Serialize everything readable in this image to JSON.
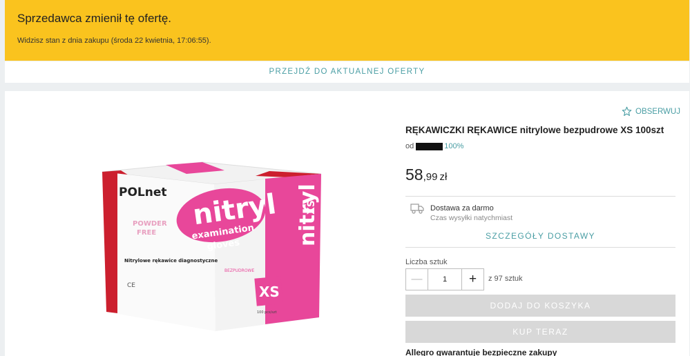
{
  "notice": {
    "title": "Sprzedawca zmienił tę ofertę.",
    "subtitle": "Widzisz stan z dnia zakupu (środa 22 kwietnia, 17:06:55)."
  },
  "current_offer_link": "PRZEJDŹ DO AKTUALNEJ OFERTY",
  "product": {
    "title": "RĘKAWICZKI RĘKAWICE nitrylowe bezpudrowe XS 100szt",
    "seller_prefix": "od",
    "seller_rating": "100%",
    "price_int": "58",
    "price_dec": ",99",
    "currency": "zł",
    "watch_label": "OBSERWUJ"
  },
  "box_art": {
    "brand": "POLnet",
    "powder_free_1": "POWDER",
    "powder_free_2": "FREE",
    "name": "nitryl",
    "examination": "examination",
    "gloves": "gloves",
    "desc": "Nitrylowe rękawice diagnostyczne",
    "bezpudrowe": "BEZPUDROWE",
    "size": "XS",
    "side_name": "nitryl",
    "side_size": "XS",
    "count": "100 pcs/szt",
    "ce": "CE"
  },
  "shipping": {
    "title": "Dostawa za darmo",
    "subtitle": "Czas wysyłki natychmiast",
    "details_link": "SZCZEGÓŁY DOSTAWY"
  },
  "quantity": {
    "label": "Liczba sztuk",
    "value": "1",
    "minus": "—",
    "plus": "+",
    "available": "z 97 sztuk"
  },
  "buttons": {
    "add_to_cart": "DODAJ DO KOSZYKA",
    "buy_now": "KUP TERAZ"
  },
  "guarantee": "Allegro gwarantuje bezpieczne zakupy",
  "colors": {
    "notice_bg": "#fac31e",
    "accent": "#4a9ea4",
    "disabled_button": "#d8d8d8",
    "box_pink": "#e8479a",
    "box_red": "#cc1f2e"
  }
}
